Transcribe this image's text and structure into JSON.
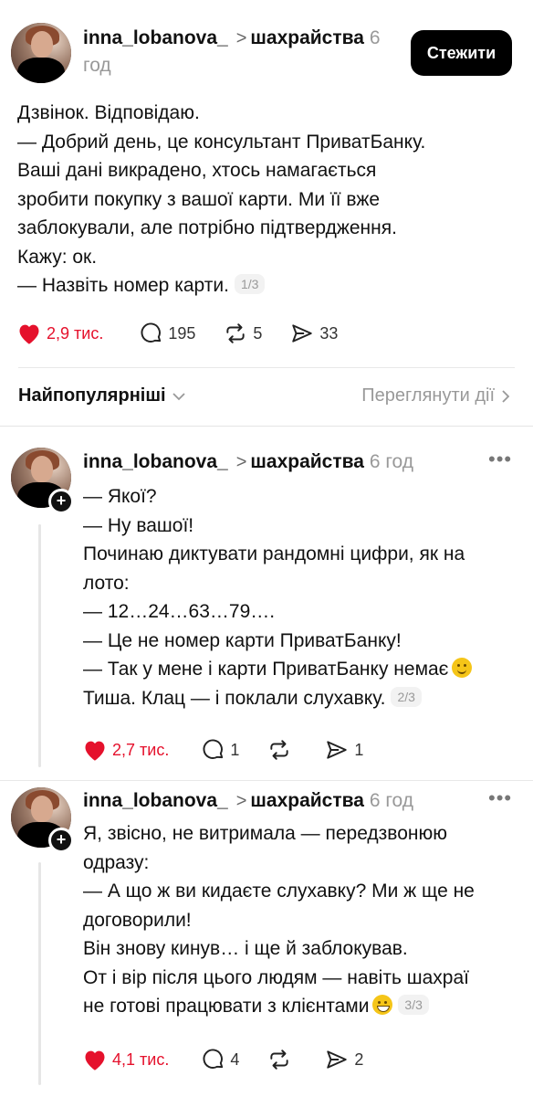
{
  "post": {
    "username": "inna_lobanova_",
    "topic": "шахрайства",
    "time_a": "6",
    "time_b": "год",
    "follow_label": "Стежити",
    "lines": [
      "Дзвінок. Відповідаю.",
      "— Добрий день, це консультант ПриватБанку.",
      "Ваші дані викрадено, хтось намагається",
      "зробити покупку з вашої карти. Ми її вже",
      "заблокували, але потрібно підтвердження.",
      "Кажу: ок.",
      "— Назвіть номер карти."
    ],
    "counter": "1/3",
    "likes": "2,9 тис.",
    "replies": "195",
    "reposts": "5",
    "shares": "33"
  },
  "sort": {
    "label": "Найпопулярніші",
    "activity_label": "Переглянути дії"
  },
  "reply1": {
    "username": "inna_lobanova_",
    "topic": "шахрайства",
    "time": "6 год",
    "more": "•••",
    "lines": [
      "— Якої?",
      "— Ну вашої!",
      "Починаю диктувати рандомні цифри, як на",
      "лото:",
      "— 12…24…63…79….",
      "— Це не номер карти ПриватБанку!",
      "— Так у мене і карти ПриватБанку немає",
      "Тиша. Клац — і поклали слухавку."
    ],
    "counter": "2/3",
    "likes": "2,7 тис.",
    "replies": "1",
    "reposts": "",
    "shares": "1"
  },
  "reply2": {
    "username": "inna_lobanova_",
    "topic": "шахрайства",
    "time": "6 год",
    "more": "•••",
    "lines": [
      "Я, звісно, не витримала — передзвонюю",
      "одразу:",
      "— А що ж ви кидаєте слухавку? Ми ж ще не",
      "договорили!",
      "Він знову кинув… і ще й заблокував.",
      "От і вір після цього людям — навіть шахраї",
      "не готові працювати з клієнтами"
    ],
    "counter": "3/3",
    "likes": "4,1 тис.",
    "replies": "4",
    "reposts": "",
    "shares": "2"
  },
  "colors": {
    "like": "#e5112c",
    "follow_bg": "#000000",
    "muted": "#999999"
  },
  "icons": [
    "heart-icon",
    "comment-icon",
    "repost-icon",
    "share-icon",
    "chevron-down-icon",
    "chevron-right-icon",
    "more-icon",
    "plus-icon",
    "slightly-smiling-emoji",
    "grinning-emoji"
  ]
}
